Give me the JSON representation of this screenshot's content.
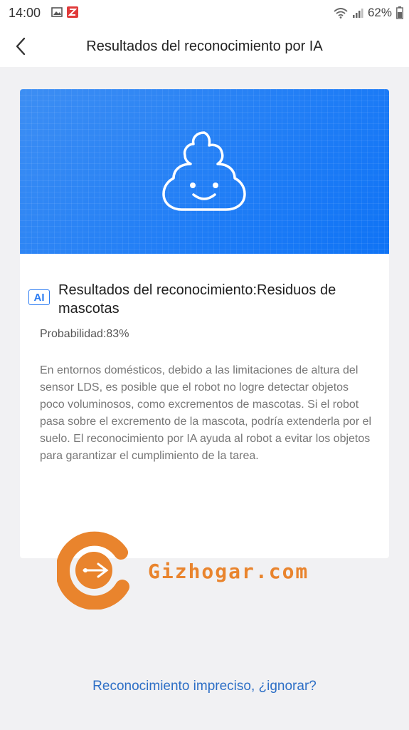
{
  "status_bar": {
    "time": "14:00",
    "battery": "62%",
    "icons": [
      "image-icon",
      "app-notification-icon",
      "wifi-icon",
      "signal-icon",
      "battery-icon"
    ]
  },
  "header": {
    "back_icon": "chevron-left-icon",
    "title": "Resultados del reconocimiento por IA"
  },
  "card": {
    "hero_icon": "poop-icon",
    "hero_color": "#1f7df6",
    "ai_badge": "AI",
    "result_title": "Resultados del reconocimiento:Residuos de mascotas",
    "probability": "Probabilidad:83%",
    "description": "En entornos domésticos, debido a las limitaciones de altura del sensor LDS, es posible que el robot no logre detectar objetos poco voluminosos, como excrementos de mascotas. Si el robot pasa sobre el excremento de la mascota, podría extenderla por el suelo. El reconocimiento por IA ayuda al robot a evitar los objetos para garantizar el cumplimiento de la tarea."
  },
  "watermark": {
    "text": "Gizhogar.com",
    "color": "#e9842d"
  },
  "footer": {
    "ignore_link": "Reconocimiento impreciso, ¿ignorar?",
    "link_color": "#2d6fc6"
  }
}
